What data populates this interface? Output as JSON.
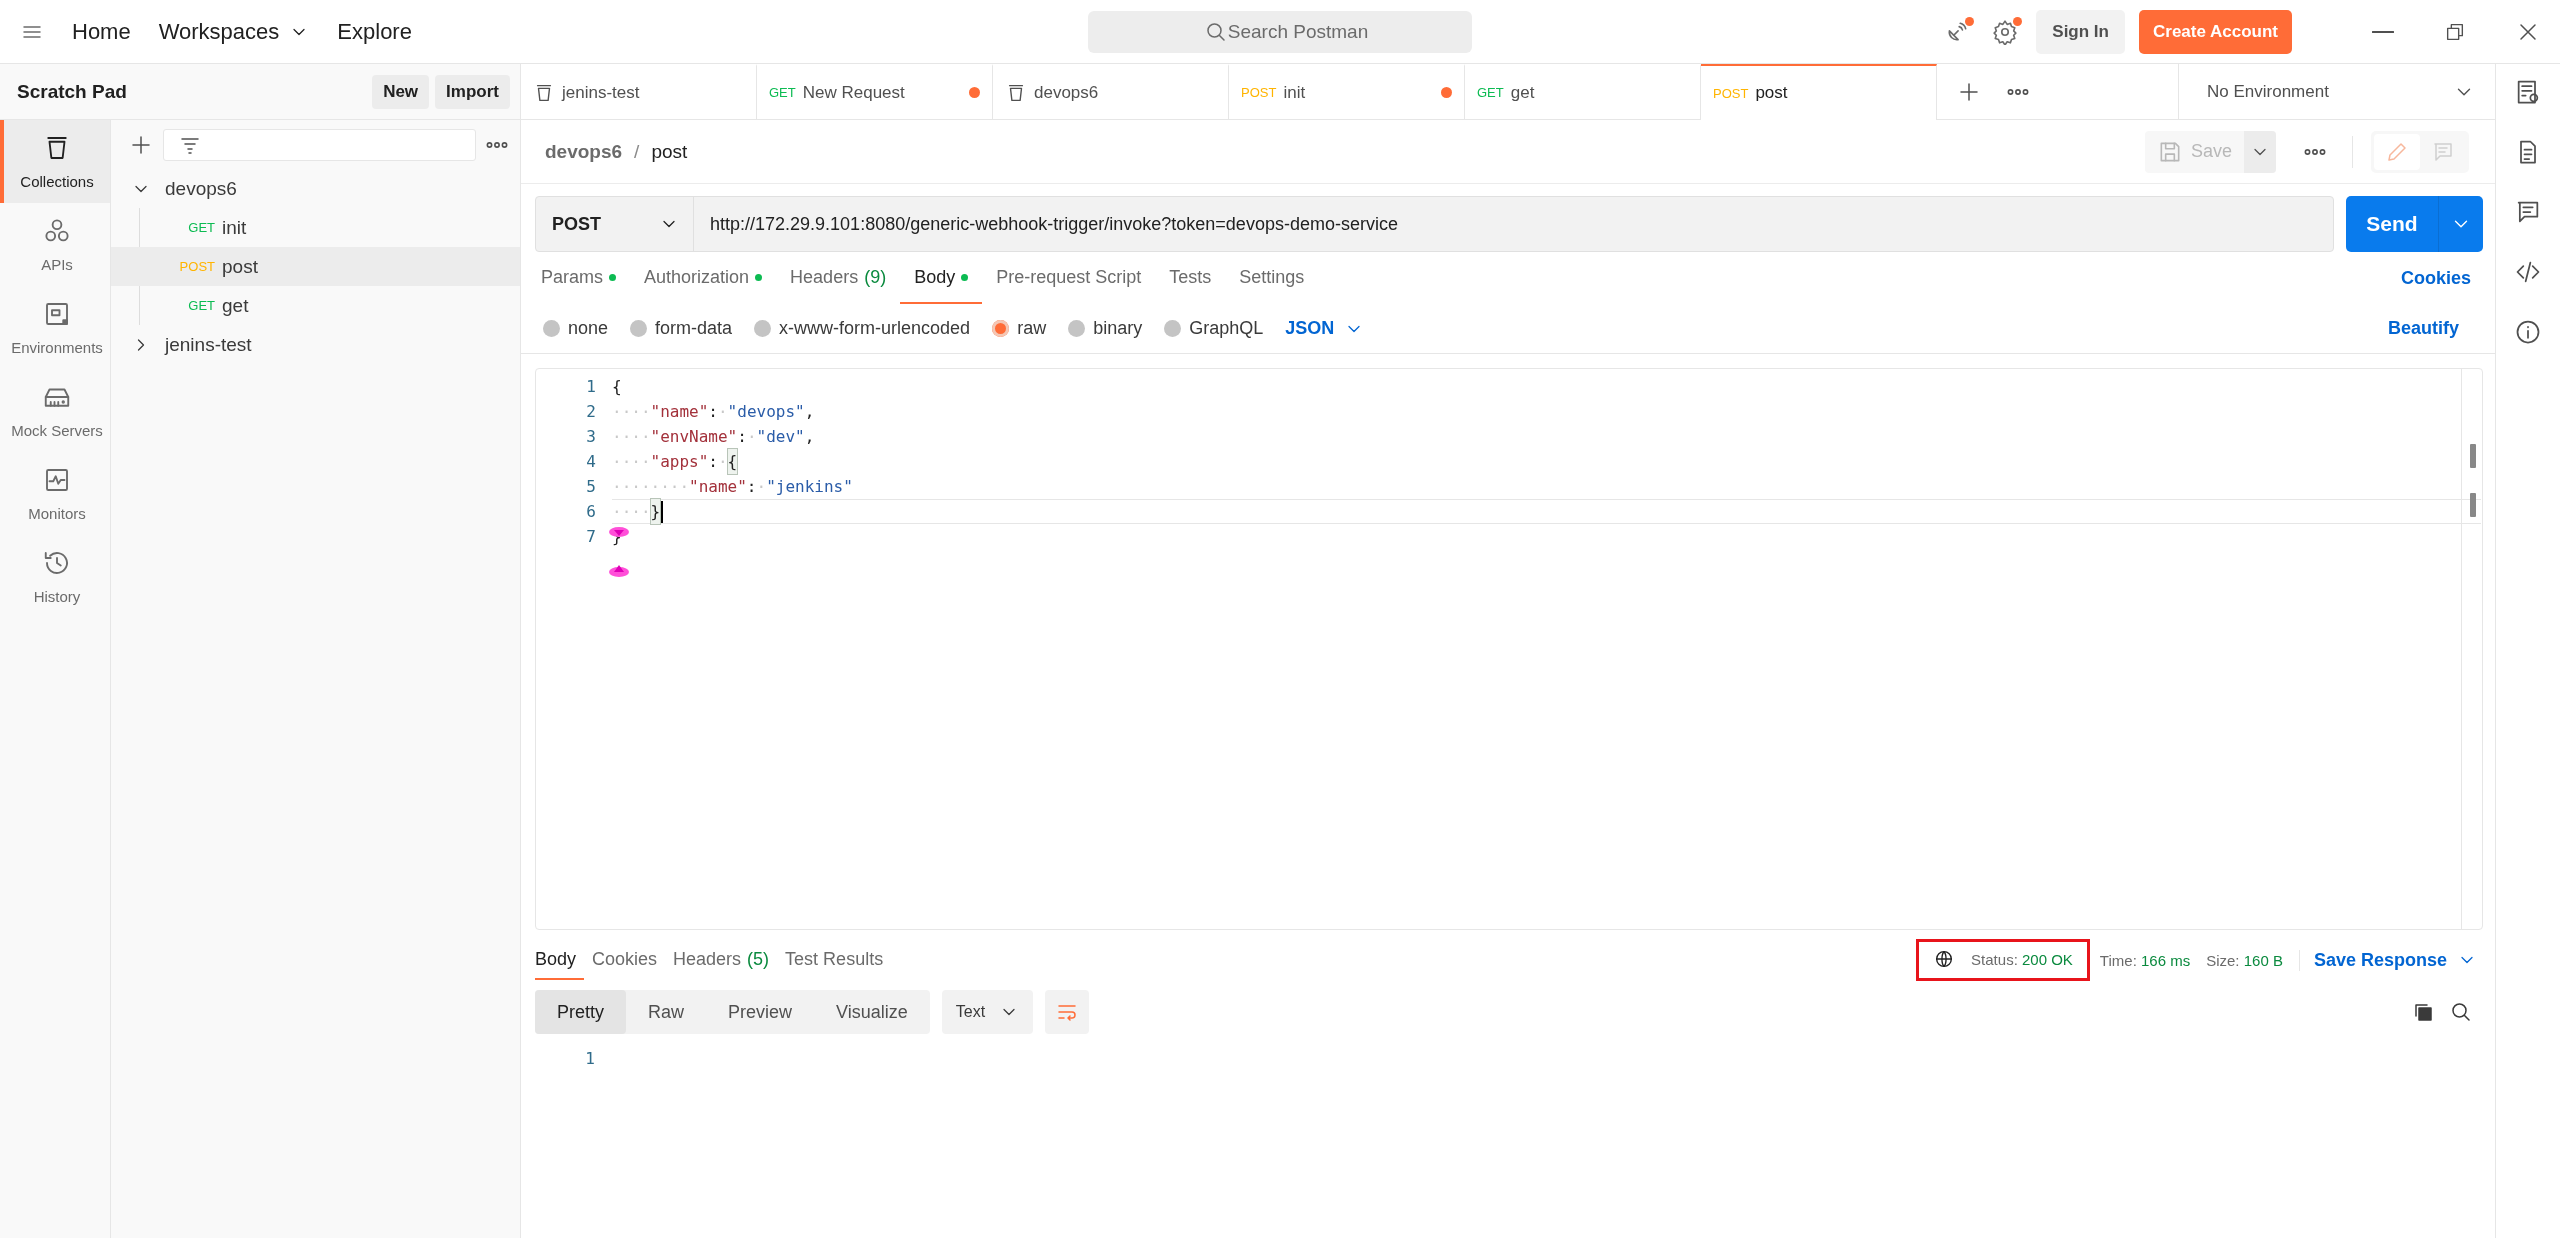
{
  "topbar": {
    "nav": [
      {
        "label": "Home",
        "kind": "link"
      },
      {
        "label": "Workspaces",
        "kind": "dropdown"
      },
      {
        "label": "Explore",
        "kind": "link"
      }
    ],
    "search": {
      "placeholder": "Search Postman"
    },
    "notifications": [
      {
        "kind": "satellite",
        "unread": true
      },
      {
        "kind": "settings",
        "unread": true
      }
    ],
    "sign_in": "Sign In",
    "create_account": "Create Account"
  },
  "sidebar": {
    "title": "Scratch Pad",
    "buttons": [
      "New",
      "Import"
    ],
    "rail": [
      {
        "label": "Collections",
        "selected": true
      },
      {
        "label": "APIs",
        "selected": false
      },
      {
        "label": "Environments",
        "selected": false
      },
      {
        "label": "Mock Servers",
        "selected": false
      },
      {
        "label": "Monitors",
        "selected": false
      },
      {
        "label": "History",
        "selected": false
      }
    ],
    "tree": [
      {
        "name": "devops6",
        "expanded": true,
        "children": [
          {
            "method": "GET",
            "color": "#0cbb52",
            "name": "init",
            "selected": false
          },
          {
            "method": "POST",
            "color": "#ffb400",
            "name": "post",
            "selected": true
          },
          {
            "method": "GET",
            "color": "#0cbb52",
            "name": "get",
            "selected": false
          }
        ]
      },
      {
        "name": "jenins-test",
        "expanded": false
      }
    ]
  },
  "tabs": [
    {
      "kind": "collection",
      "label": "jenins-test",
      "selected": false,
      "unsaved": false
    },
    {
      "kind": "request",
      "method": "GET",
      "color": "#0cbb52",
      "label": "New Request",
      "selected": false,
      "unsaved": true
    },
    {
      "kind": "collection",
      "label": "devops6",
      "selected": false,
      "unsaved": false
    },
    {
      "kind": "request",
      "method": "POST",
      "color": "#ffb400",
      "label": "init",
      "selected": false,
      "unsaved": true
    },
    {
      "kind": "request",
      "method": "GET",
      "color": "#0cbb52",
      "label": "get",
      "selected": false,
      "unsaved": false
    },
    {
      "kind": "request",
      "method": "POST",
      "color": "#ffb400",
      "label": "post",
      "selected": true,
      "unsaved": false
    }
  ],
  "environment": "No Environment",
  "request": {
    "breadcrumb": [
      "devops6",
      "post"
    ],
    "breadcrumb_separator": "/",
    "save": "Save",
    "method": "POST",
    "url": "http://172.29.9.101:8080/generic-webhook-trigger/invoke?token=devops-demo-service",
    "send": "Send",
    "tabs": [
      {
        "label": "Params",
        "dot": true,
        "selected": false
      },
      {
        "label": "Authorization",
        "dot": true,
        "selected": false
      },
      {
        "label": "Headers",
        "count": "(9)",
        "dot": false,
        "selected": false
      },
      {
        "label": "Body",
        "dot": true,
        "selected": true
      },
      {
        "label": "Pre-request Script",
        "dot": false,
        "selected": false
      },
      {
        "label": "Tests",
        "dot": false,
        "selected": false
      },
      {
        "label": "Settings",
        "dot": false,
        "selected": false
      }
    ],
    "cookies": "Cookies",
    "body_types": [
      {
        "label": "none",
        "selected": false
      },
      {
        "label": "form-data",
        "selected": false
      },
      {
        "label": "x-www-form-urlencoded",
        "selected": false
      },
      {
        "label": "raw",
        "selected": true
      },
      {
        "label": "binary",
        "selected": false
      },
      {
        "label": "GraphQL",
        "selected": false
      }
    ],
    "format": "JSON",
    "beautify": "Beautify",
    "code": [
      {
        "number": "1",
        "cursor": false,
        "tokens": [
          {
            "kind": "punct",
            "text": "{"
          }
        ]
      },
      {
        "number": "2",
        "cursor": false,
        "tokens": [
          {
            "kind": "guide",
            "text": "····"
          },
          {
            "kind": "key",
            "text": "\"name\""
          },
          {
            "kind": "punct",
            "text": ":"
          },
          {
            "kind": "guide",
            "text": "·"
          },
          {
            "kind": "string",
            "text": "\"devops\""
          },
          {
            "kind": "punct",
            "text": ","
          }
        ]
      },
      {
        "number": "3",
        "cursor": false,
        "tokens": [
          {
            "kind": "guide",
            "text": "····"
          },
          {
            "kind": "key",
            "text": "\"envName\""
          },
          {
            "kind": "punct",
            "text": ":"
          },
          {
            "kind": "guide",
            "text": "·"
          },
          {
            "kind": "string",
            "text": "\"dev\""
          },
          {
            "kind": "punct",
            "text": ","
          }
        ]
      },
      {
        "number": "4",
        "cursor": false,
        "tokens": [
          {
            "kind": "guide",
            "text": "····"
          },
          {
            "kind": "key",
            "text": "\"apps\""
          },
          {
            "kind": "punct",
            "text": ":"
          },
          {
            "kind": "guide",
            "text": "·"
          },
          {
            "kind": "match",
            "text": "{"
          }
        ]
      },
      {
        "number": "5",
        "cursor": false,
        "tokens": [
          {
            "kind": "guide",
            "text": "········"
          },
          {
            "kind": "key",
            "text": "\"name\""
          },
          {
            "kind": "punct",
            "text": ":"
          },
          {
            "kind": "guide",
            "text": "·"
          },
          {
            "kind": "string",
            "text": "\"jenkins\""
          }
        ]
      },
      {
        "number": "6",
        "cursor": true,
        "tokens": [
          {
            "kind": "guide",
            "text": "····"
          },
          {
            "kind": "match",
            "text": "}"
          }
        ]
      },
      {
        "number": "7",
        "cursor": false,
        "tokens": [
          {
            "kind": "punct",
            "text": "}"
          }
        ]
      }
    ]
  },
  "response": {
    "tabs": [
      {
        "label": "Body",
        "selected": true
      },
      {
        "label": "Cookies",
        "selected": false
      },
      {
        "label": "Headers",
        "count": "(5)",
        "selected": false
      },
      {
        "label": "Test Results",
        "selected": false
      }
    ],
    "status_label": "Status:",
    "status": "200 OK",
    "time_label": "Time:",
    "time": "166 ms",
    "size_label": "Size:",
    "size": "160 B",
    "highlighted": true,
    "save_response": "Save Response",
    "views": [
      {
        "label": "Pretty",
        "selected": true
      },
      {
        "label": "Raw",
        "selected": false
      },
      {
        "label": "Preview",
        "selected": false
      },
      {
        "label": "Visualize",
        "selected": false
      }
    ],
    "format": "Text",
    "lines": [
      "1"
    ]
  }
}
